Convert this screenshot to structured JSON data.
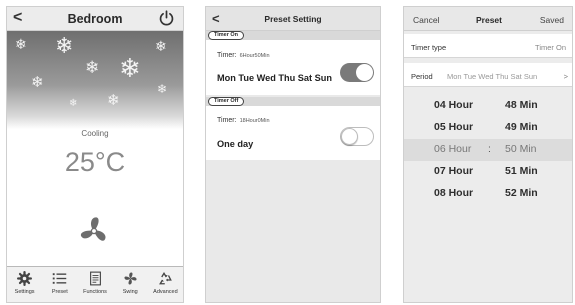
{
  "panel1": {
    "title": "Bedroom",
    "mode": "Cooling",
    "temperature": "25°C",
    "icons": {
      "back": "chevron-left-icon",
      "power": "power-icon",
      "fan": "fan-icon"
    },
    "tabs": [
      {
        "label": "Settings",
        "icon": "gear-icon"
      },
      {
        "label": "Preset",
        "icon": "list-icon"
      },
      {
        "label": "Functions",
        "icon": "document-icon"
      },
      {
        "label": "Swing",
        "icon": "swing-icon"
      },
      {
        "label": "Advanced",
        "icon": "recycle-icon"
      }
    ]
  },
  "panel2": {
    "title": "Preset Setting",
    "timer_on": {
      "badge": "Timer On",
      "label": "Timer:",
      "value": "6Hour50Min",
      "days": "Mon Tue Wed Thu Sat Sun",
      "enabled": true
    },
    "timer_off": {
      "badge": "Timer Off",
      "label": "Timer:",
      "value": "18Hour0Min",
      "days": "One day",
      "enabled": false
    }
  },
  "panel3": {
    "cancel": "Cancel",
    "title": "Preset",
    "saved": "Saved",
    "timer_type_label": "Timer type",
    "timer_type_value": "Timer On",
    "period_label": "Period",
    "period_value": "Mon Tue Wed Thu Sat Sun",
    "period_chevron": ">",
    "picker": [
      {
        "hour": "04 Hour",
        "min": "48 Min",
        "selected": false
      },
      {
        "hour": "05 Hour",
        "min": "49 Min",
        "selected": false
      },
      {
        "hour": "06 Hour",
        "min": "50 Min",
        "selected": true
      },
      {
        "hour": "07 Hour",
        "min": "51 Min",
        "selected": false
      },
      {
        "hour": "08 Hour",
        "min": "52 Min",
        "selected": false
      }
    ],
    "separator": ":"
  },
  "colors": {
    "header_bg": "#ececec",
    "toggle_on": "#7a7a7a",
    "selected_row": "#dcdcdc"
  }
}
